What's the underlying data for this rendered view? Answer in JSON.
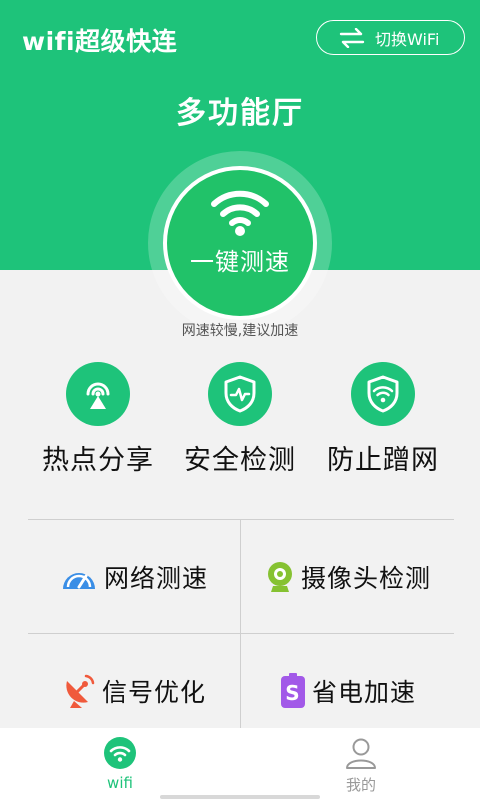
{
  "app": {
    "title": "wifi超级快连"
  },
  "header": {
    "switch_label": "切换WiFi",
    "hall_title": "多功能厅"
  },
  "speed": {
    "button_label": "一键测速",
    "hint": "网速较慢,建议加速"
  },
  "features": [
    {
      "label": "热点分享",
      "icon": "hotspot-icon"
    },
    {
      "label": "安全检测",
      "icon": "shield-pulse-icon"
    },
    {
      "label": "防止蹭网",
      "icon": "shield-wifi-icon"
    }
  ],
  "tools": [
    {
      "label": "网络测速",
      "icon": "speedometer-icon",
      "color": "#3a8ee6"
    },
    {
      "label": "摄像头检测",
      "icon": "webcam-icon",
      "color": "#86c232"
    },
    {
      "label": "信号优化",
      "icon": "satellite-dish-icon",
      "color": "#f05a3c"
    },
    {
      "label": "省电加速",
      "icon": "battery-icon",
      "color": "#a259e8"
    }
  ],
  "tabbar": {
    "tab_wifi": "wifi",
    "tab_mine": "我的"
  },
  "colors": {
    "brand_green": "#1ec37a",
    "active_tab": "#1ec37a",
    "inactive_tab": "#999999"
  }
}
